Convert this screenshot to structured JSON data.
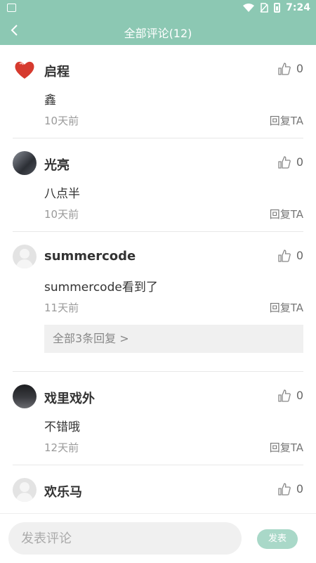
{
  "status_bar": {
    "time": "7:24"
  },
  "header": {
    "title": "全部评论(12)"
  },
  "comments": [
    {
      "name": "启程",
      "likes": "0",
      "text": "鑫",
      "time": "10天前",
      "reply": "回复TA",
      "avatar": "heart-avatar"
    },
    {
      "name": "光亮",
      "likes": "0",
      "text": "八点半",
      "time": "10天前",
      "reply": "回复TA",
      "avatar": "photo-avatar"
    },
    {
      "name": "summercode",
      "likes": "0",
      "text": "summercode看到了",
      "time": "11天前",
      "reply": "回复TA",
      "more_replies": "全部3条回复 >",
      "avatar": "default-avatar"
    },
    {
      "name": "戏里戏外",
      "likes": "0",
      "text": "不错哦",
      "time": "12天前",
      "reply": "回复TA",
      "avatar": "photo-avatar"
    },
    {
      "name": "欢乐马",
      "likes": "0",
      "avatar": "default-avatar"
    }
  ],
  "footer": {
    "input_placeholder": "发表评论",
    "send_label": "发表"
  },
  "colors": {
    "accent": "#8cc8b3",
    "send_button": "#a9d8c8"
  }
}
